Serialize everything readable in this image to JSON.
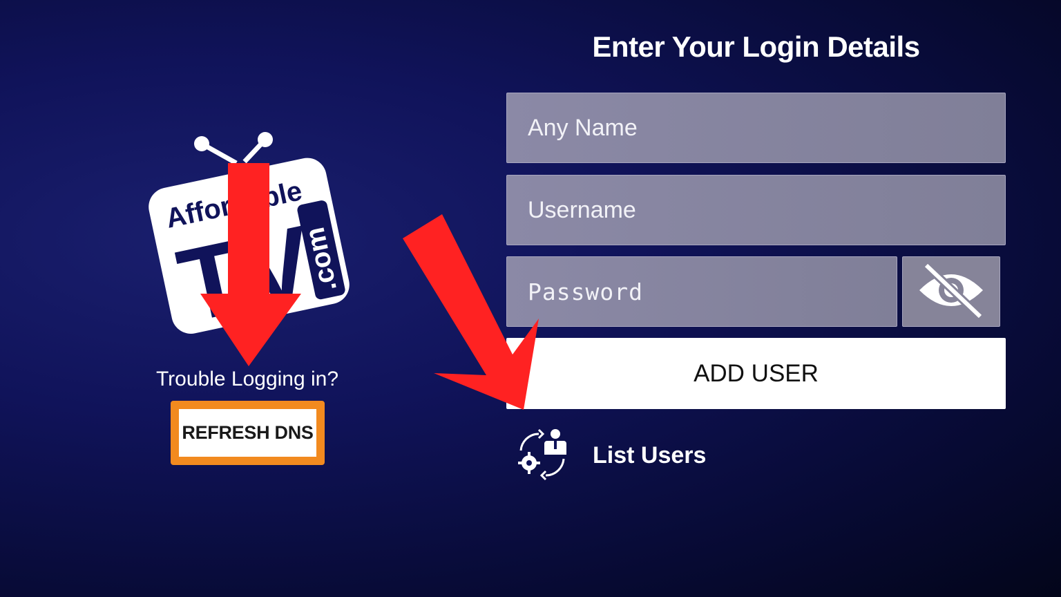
{
  "logo": {
    "line1": "Affordable",
    "line2": "TV",
    "line3": ".com"
  },
  "left": {
    "trouble_text": "Trouble Logging in?",
    "refresh_label": "REFRESH DNS"
  },
  "form": {
    "title": "Enter Your Login Details",
    "any_name_placeholder": "Any Name",
    "username_placeholder": "Username",
    "password_placeholder": "Password",
    "add_user_label": "ADD USER",
    "list_users_label": "List Users"
  },
  "icons": {
    "eye_toggle": "eye-slash-icon",
    "list_users": "user-settings-sync-icon"
  },
  "colors": {
    "accent_orange": "#f28a1f",
    "annotation_red": "#ff2222"
  }
}
